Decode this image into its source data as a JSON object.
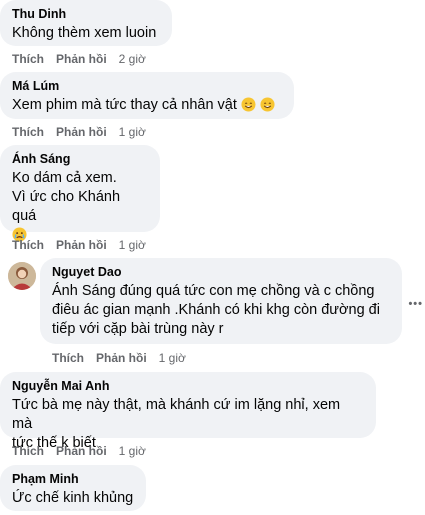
{
  "comments": [
    {
      "name": "Thu Dinh",
      "text": "Không thèm xem luoin",
      "like": "Thích",
      "reply": "Phản hồi",
      "time": "2 giờ"
    },
    {
      "name": "Má Lúm",
      "text": "Xem phim mà tức thay cả nhân vật",
      "emoji": "sweat-smile-icon",
      "like": "Thích",
      "reply": "Phản hồi",
      "time": "1 giờ"
    },
    {
      "name": "Ánh Sáng",
      "line1": "Ko dám cả xem.",
      "line2": "Vì ức cho Khánh quá",
      "emoji": "crying-face-icon",
      "like": "Thích",
      "reply": "Phản hồi",
      "time": "1 giờ"
    },
    {
      "name": "Nguyet Dao",
      "mention": "Ánh Sáng",
      "line1": " đúng quá tức con mẹ chồng và c chồng",
      "line2": "điêu ác gian mạnh .Khánh có khi khg còn đường đi",
      "line3": "tiếp với cặp bài trùng này r",
      "more": "•••",
      "like": "Thích",
      "reply": "Phản hồi",
      "time": "1 giờ"
    },
    {
      "name": "Nguyễn Mai Anh",
      "line1": "Tức bà mẹ này thật, mà khánh cứ im lặng nhỉ, xem mà",
      "line2": "tức thế k biết",
      "like": "Thích",
      "reply": "Phản hồi",
      "time": "1 giờ"
    },
    {
      "name": "Phạm Minh",
      "text": "Ức chế kinh khủng"
    }
  ],
  "colors": {
    "bubble": "#f0f2f5",
    "meta": "#65676b",
    "text": "#050505"
  }
}
